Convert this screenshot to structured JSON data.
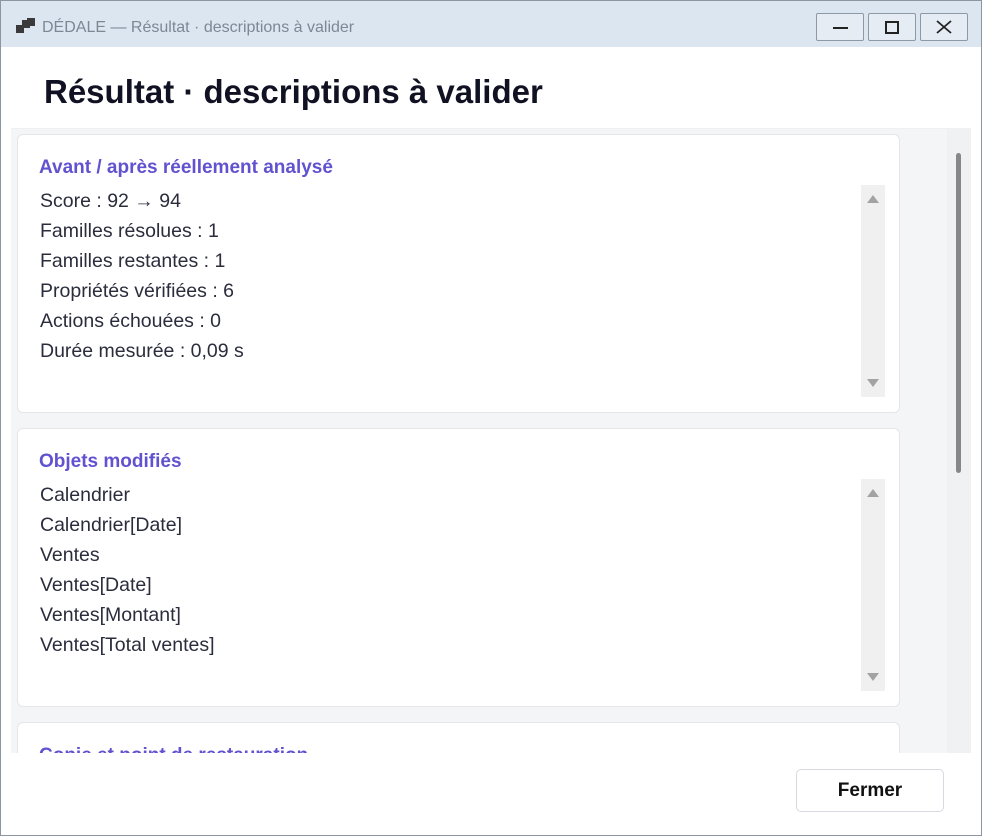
{
  "window": {
    "title": "DÉDALE — Résultat · descriptions à valider",
    "controls": {
      "minimize": "minimize",
      "maximize": "maximize",
      "close": "close"
    }
  },
  "header": {
    "title": "Résultat · descriptions à valider"
  },
  "sections": [
    {
      "title": "Avant / après réellement analysé",
      "lines": [
        "Score : 92 → 94",
        "Familles résolues : 1",
        "Familles restantes : 1",
        "Propriétés vérifiées : 6",
        "Actions échouées : 0",
        "Durée mesurée : 0,09 s"
      ]
    },
    {
      "title": "Objets modifiés",
      "lines": [
        "Calendrier",
        "Calendrier[Date]",
        "Ventes",
        "Ventes[Date]",
        "Ventes[Montant]",
        "Ventes[Total ventes]"
      ]
    },
    {
      "title": "Copie et point de restauration"
    }
  ],
  "footer": {
    "close_label": "Fermer"
  },
  "colors": {
    "accent": "#6152cf",
    "title_text": "#101223",
    "body_text": "#2b2d3d",
    "titlebar": "#dbe6f1"
  }
}
